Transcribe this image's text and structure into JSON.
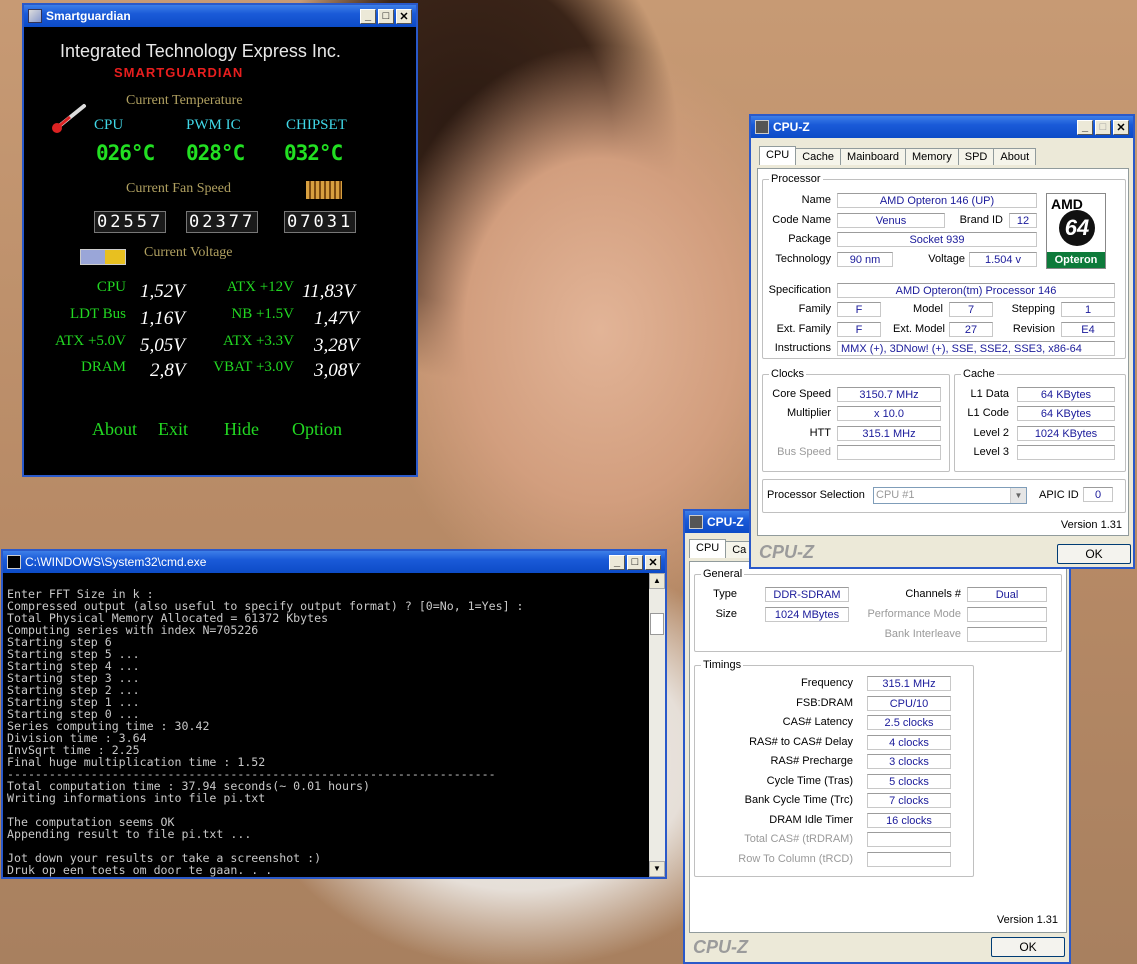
{
  "smartguardian": {
    "title": "Smartguardian",
    "company": "Integrated Technology Express Inc.",
    "brand": "SMARTGUARDIAN",
    "temp_heading": "Current Temperature",
    "temp_labels": [
      "CPU",
      "PWM IC",
      "CHIPSET"
    ],
    "temps": [
      "026°C",
      "028°C",
      "032°C"
    ],
    "fan_heading": "Current Fan Speed",
    "fans": [
      "02557",
      "02377",
      "07031"
    ],
    "voltage_heading": "Current Voltage",
    "voltages": [
      {
        "label": "CPU",
        "value": "1,52V"
      },
      {
        "label": "ATX +12V",
        "value": "11,83V"
      },
      {
        "label": "LDT Bus",
        "value": "1,16V"
      },
      {
        "label": "NB +1.5V",
        "value": "1,47V"
      },
      {
        "label": "ATX +5.0V",
        "value": "5,05V"
      },
      {
        "label": "ATX +3.3V",
        "value": "3,28V"
      },
      {
        "label": "DRAM",
        "value": "2,8V"
      },
      {
        "label": "VBAT +3.0V",
        "value": "3,08V"
      }
    ],
    "buttons": [
      "About",
      "Exit",
      "Hide",
      "Option"
    ]
  },
  "cmd": {
    "title": "C:\\WINDOWS\\System32\\cmd.exe",
    "lines": [
      "Enter FFT Size in k :",
      "Compressed output (also useful to specify output format) ? [0=No, 1=Yes] :",
      "Total Physical Memory Allocated = 61372 Kbytes",
      "Computing series with index N=705226",
      "Starting step 6",
      "Starting step 5 ...",
      "Starting step 4 ...",
      "Starting step 3 ...",
      "Starting step 2 ...",
      "Starting step 1 ...",
      "Starting step 0 ...",
      "Series computing time : 30.42",
      "Division time : 3.64",
      "InvSqrt time : 2.25",
      "Final huge multiplication time : 1.52",
      "----------------------------------------------------------------------",
      "Total computation time : 37.94 seconds(~ 0.01 hours)",
      "Writing informations into file pi.txt",
      "",
      "The computation seems OK",
      "Appending result to file pi.txt ...",
      "",
      "Jot down your results or take a screenshot :)",
      "Druk op een toets om door te gaan. . ."
    ]
  },
  "cpuz_main": {
    "title": "CPU-Z",
    "tabs": [
      "CPU",
      "Cache",
      "Mainboard",
      "Memory",
      "SPD",
      "About"
    ],
    "processor_group": "Processor",
    "name_label": "Name",
    "name": "AMD Opteron 146 (UP)",
    "codename_label": "Code Name",
    "codename": "Venus",
    "brandid_label": "Brand ID",
    "brandid": "12",
    "package_label": "Package",
    "package": "Socket 939",
    "technology_label": "Technology",
    "technology": "90 nm",
    "voltage_label": "Voltage",
    "voltage": "1.504 v",
    "spec_label": "Specification",
    "spec": "AMD Opteron(tm) Processor 146",
    "family_label": "Family",
    "family": "F",
    "model_label": "Model",
    "model": "7",
    "stepping_label": "Stepping",
    "stepping": "1",
    "extfamily_label": "Ext. Family",
    "extfamily": "F",
    "extmodel_label": "Ext. Model",
    "extmodel": "27",
    "revision_label": "Revision",
    "revision": "E4",
    "instructions_label": "Instructions",
    "instructions": "MMX (+), 3DNow! (+), SSE, SSE2, SSE3, x86-64",
    "logo_top": "AMD",
    "logo_mid": "64",
    "logo_bottom": "Opteron",
    "clocks_group": "Clocks",
    "corespeed_label": "Core Speed",
    "corespeed": "3150.7 MHz",
    "multiplier_label": "Multiplier",
    "multiplier": "x 10.0",
    "htt_label": "HTT",
    "htt": "315.1 MHz",
    "busspeed_label": "Bus Speed",
    "busspeed": "",
    "cache_group": "Cache",
    "l1data_label": "L1 Data",
    "l1data": "64 KBytes",
    "l1code_label": "L1 Code",
    "l1code": "64 KBytes",
    "level2_label": "Level 2",
    "level2": "1024 KBytes",
    "level3_label": "Level 3",
    "level3": "",
    "procsel_label": "Processor Selection",
    "procsel": "CPU #1",
    "apicid_label": "APIC ID",
    "apicid": "0",
    "version": "Version 1.31",
    "logo": "CPU-Z",
    "ok": "OK"
  },
  "cpuz_mem": {
    "title": "CPU-Z",
    "tab_cpu": "CPU",
    "tab_partial": "Ca",
    "general_group": "General",
    "type_label": "Type",
    "type": "DDR-SDRAM",
    "size_label": "Size",
    "size": "1024 MBytes",
    "channels_label": "Channels #",
    "channels": "Dual",
    "perfmode_label": "Performance Mode",
    "perfmode": "",
    "bankint_label": "Bank Interleave",
    "bankint": "",
    "timings_group": "Timings",
    "timings": [
      {
        "label": "Frequency",
        "value": "315.1 MHz",
        "dis": false
      },
      {
        "label": "FSB:DRAM",
        "value": "CPU/10",
        "dis": false
      },
      {
        "label": "CAS# Latency",
        "value": "2.5 clocks",
        "dis": false
      },
      {
        "label": "RAS# to CAS# Delay",
        "value": "4 clocks",
        "dis": false
      },
      {
        "label": "RAS# Precharge",
        "value": "3 clocks",
        "dis": false
      },
      {
        "label": "Cycle Time (Tras)",
        "value": "5 clocks",
        "dis": false
      },
      {
        "label": "Bank Cycle Time (Trc)",
        "value": "7 clocks",
        "dis": false
      },
      {
        "label": "DRAM Idle Timer",
        "value": "16 clocks",
        "dis": false
      },
      {
        "label": "Total CAS# (tRDRAM)",
        "value": "",
        "dis": true
      },
      {
        "label": "Row To Column (tRCD)",
        "value": "",
        "dis": true
      }
    ],
    "version": "Version 1.31",
    "logo": "CPU-Z",
    "ok": "OK"
  }
}
